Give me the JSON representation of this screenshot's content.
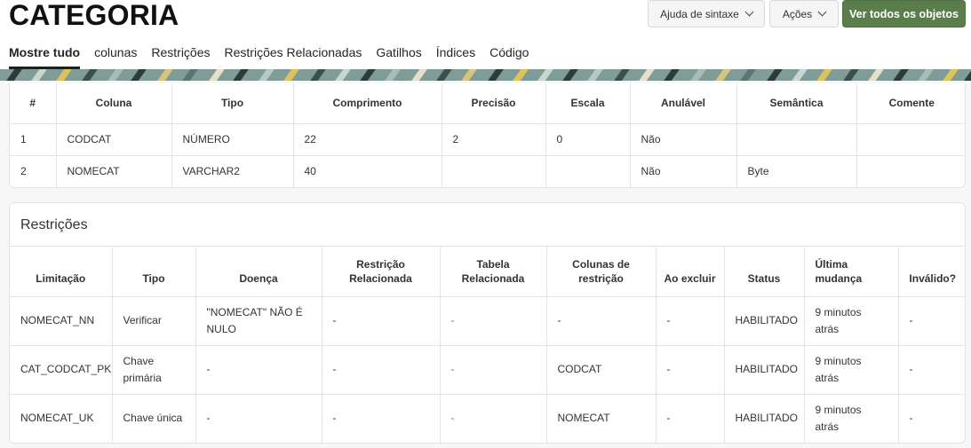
{
  "header": {
    "title": "CATEGORIA",
    "syntax_help_label": "Ajuda de sintaxe",
    "actions_label": "Ações",
    "view_all_label": "Ver todos os objetos"
  },
  "tabs": [
    "Mostre tudo",
    "colunas",
    "Restrições",
    "Restrições Relacionadas",
    "Gatilhos",
    "Índices",
    "Código"
  ],
  "columns_table": {
    "headers": [
      "#",
      "Coluna",
      "Tipo",
      "Comprimento",
      "Precisão",
      "Escala",
      "Anulável",
      "Semântica",
      "Comente"
    ],
    "rows": [
      [
        "1",
        "CODCAT",
        "NÚMERO",
        "22",
        "2",
        "0",
        "Não",
        "",
        ""
      ],
      [
        "2",
        "NOMECAT",
        "VARCHAR2",
        "40",
        "",
        "",
        "Não",
        "Byte",
        ""
      ]
    ]
  },
  "constraints": {
    "title": "Restrições",
    "headers": [
      "Limitação",
      "Tipo",
      "Doença",
      "Restrição Relacionada",
      "Tabela Relacionada",
      "Colunas de restrição",
      "Ao excluir",
      "Status",
      "Última mudança",
      "Inválido?"
    ],
    "rows": [
      [
        "NOMECAT_NN",
        "Verificar",
        "\"NOMECAT\" NÃO É NULO",
        "-",
        "-",
        "-",
        "-",
        "HABILITADO",
        "9 minutos atrás",
        "-"
      ],
      [
        "CAT_CODCAT_PK",
        "Chave primária",
        "-",
        "-",
        "-",
        "CODCAT",
        "-",
        "HABILITADO",
        "9 minutos atrás",
        "-"
      ],
      [
        "NOMECAT_UK",
        "Chave única",
        "-",
        "-",
        "-",
        "NOMECAT",
        "-",
        "HABILITADO",
        "9 minutos atrás",
        "-"
      ]
    ]
  },
  "colors": {
    "primary_button": "#5a7d4b",
    "link_teal": "#3b8a7a"
  }
}
